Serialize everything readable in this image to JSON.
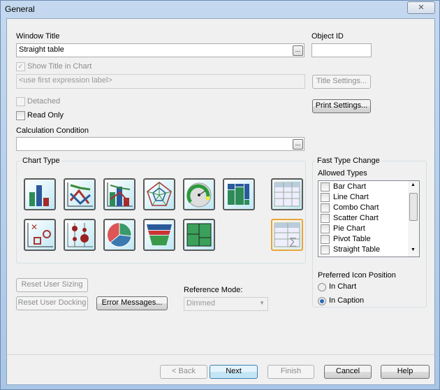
{
  "window": {
    "title": "General",
    "close_icon": "close-icon"
  },
  "window_title": {
    "label": "Window Title",
    "value": "Straight table",
    "browse": "..."
  },
  "object_id": {
    "label": "Object ID",
    "value": ""
  },
  "show_title": {
    "label": "Show Title in Chart",
    "checked": true,
    "placeholder": "<use first expression label>"
  },
  "title_settings": "Title Settings...",
  "detached": {
    "label": "Detached",
    "checked": false
  },
  "read_only": {
    "label": "Read Only",
    "checked": false
  },
  "print_settings": "Print Settings...",
  "calc_condition": {
    "label": "Calculation Condition",
    "value": "",
    "browse": "..."
  },
  "chart_type": {
    "label": "Chart Type",
    "icons": [
      "bar-chart",
      "line-chart",
      "combo-chart",
      "radar-chart",
      "gauge-chart",
      "mekko-chart",
      "pivot-table",
      "scatter-chart",
      "grid-chart",
      "pie-chart",
      "funnel-chart",
      "block-chart",
      "straight-table"
    ],
    "selected": "straight-table"
  },
  "fast_type": {
    "label": "Fast Type Change",
    "allowed_label": "Allowed Types",
    "types": [
      "Bar Chart",
      "Line Chart",
      "Combo Chart",
      "Scatter Chart",
      "Pie Chart",
      "Pivot Table",
      "Straight Table"
    ]
  },
  "icon_position": {
    "label": "Preferred Icon Position",
    "options": [
      "In Chart",
      "In Caption"
    ],
    "selected": "In Caption"
  },
  "reset_sizing": "Reset User Sizing",
  "reset_docking": "Reset User Docking",
  "error_messages": "Error Messages...",
  "reference_mode": {
    "label": "Reference Mode:",
    "value": "Dimmed"
  },
  "footer": {
    "back": "< Back",
    "next": "Next",
    "finish": "Finish",
    "cancel": "Cancel",
    "help": "Help"
  }
}
